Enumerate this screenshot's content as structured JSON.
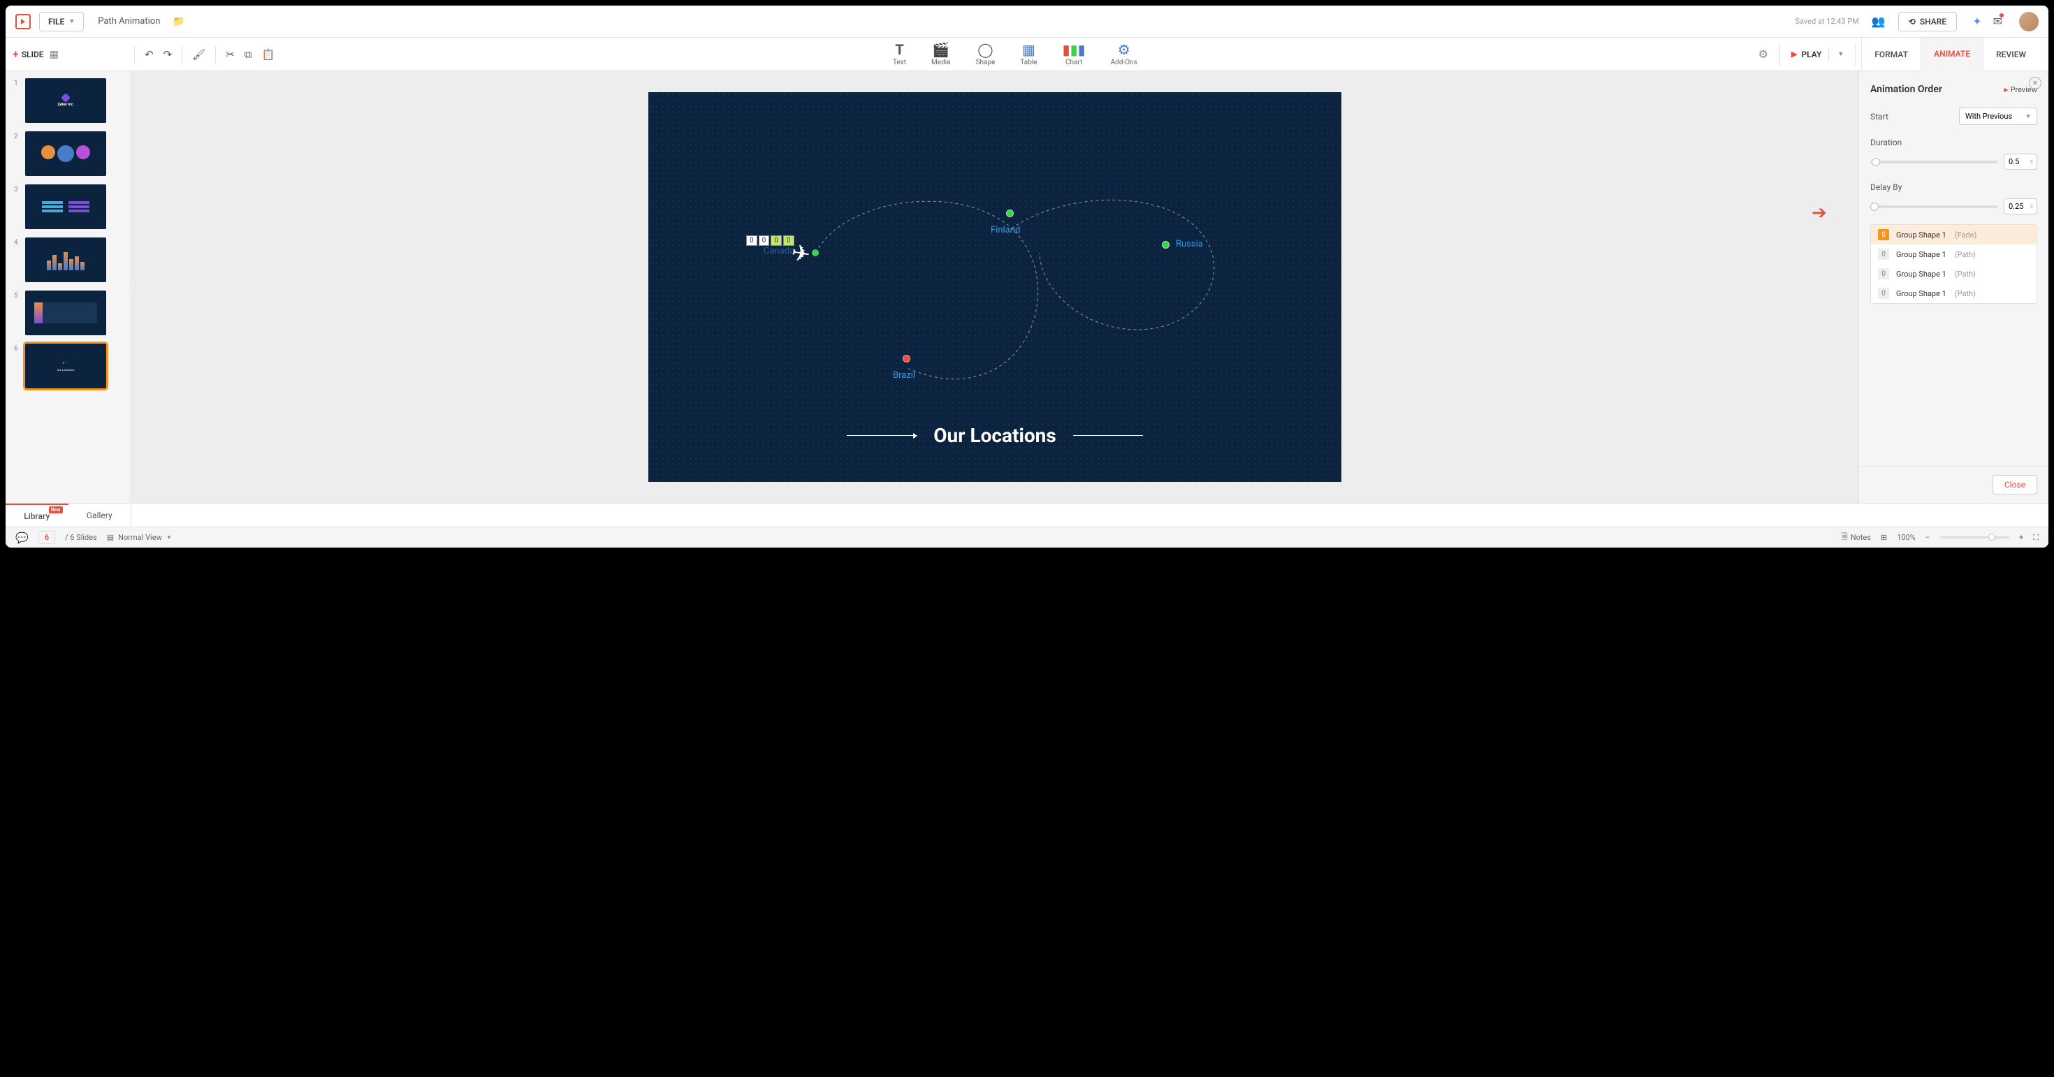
{
  "header": {
    "file_menu": "FILE",
    "doc_name": "Path Animation",
    "saved_text": "Saved at 12:43 PM",
    "share_label": "SHARE"
  },
  "toolbar": {
    "slide_btn": "SLIDE",
    "insert": {
      "text": "Text",
      "media": "Media",
      "shape": "Shape",
      "table": "Table",
      "chart": "Chart",
      "addons": "Add-Ons"
    },
    "play_label": "PLAY"
  },
  "tabs": {
    "format": "FORMAT",
    "animate": "ANIMATE",
    "review": "REVIEW"
  },
  "thumbs": [
    {
      "num": "1"
    },
    {
      "num": "2"
    },
    {
      "num": "3"
    },
    {
      "num": "4"
    },
    {
      "num": "5"
    },
    {
      "num": "6"
    }
  ],
  "slide": {
    "title": "Our Locations",
    "locations": {
      "canada": "Canada",
      "finland": "Finland",
      "russia": "Russia",
      "brazil": "Brazil"
    },
    "markers": [
      "0",
      "0",
      "0",
      "0"
    ]
  },
  "panel": {
    "title": "Animation Order",
    "preview": "Preview",
    "start_label": "Start",
    "start_value": "With Previous",
    "duration_label": "Duration",
    "duration_value": "0.5",
    "delay_label": "Delay By",
    "delay_value": "0.25",
    "items": [
      {
        "order": "0",
        "name": "Group Shape 1",
        "type": "(Fade)"
      },
      {
        "order": "0",
        "name": "Group Shape 1",
        "type": "(Path)"
      },
      {
        "order": "0",
        "name": "Group Shape 1",
        "type": "(Path)"
      },
      {
        "order": "0",
        "name": "Group Shape 1",
        "type": "(Path)"
      }
    ],
    "close": "Close"
  },
  "bottom_tabs": {
    "library": "Library",
    "library_badge": "New",
    "gallery": "Gallery"
  },
  "status": {
    "current_slide": "6",
    "total_text": "/ 6 Slides",
    "view_mode": "Normal View",
    "notes": "Notes",
    "zoom": "100%"
  }
}
